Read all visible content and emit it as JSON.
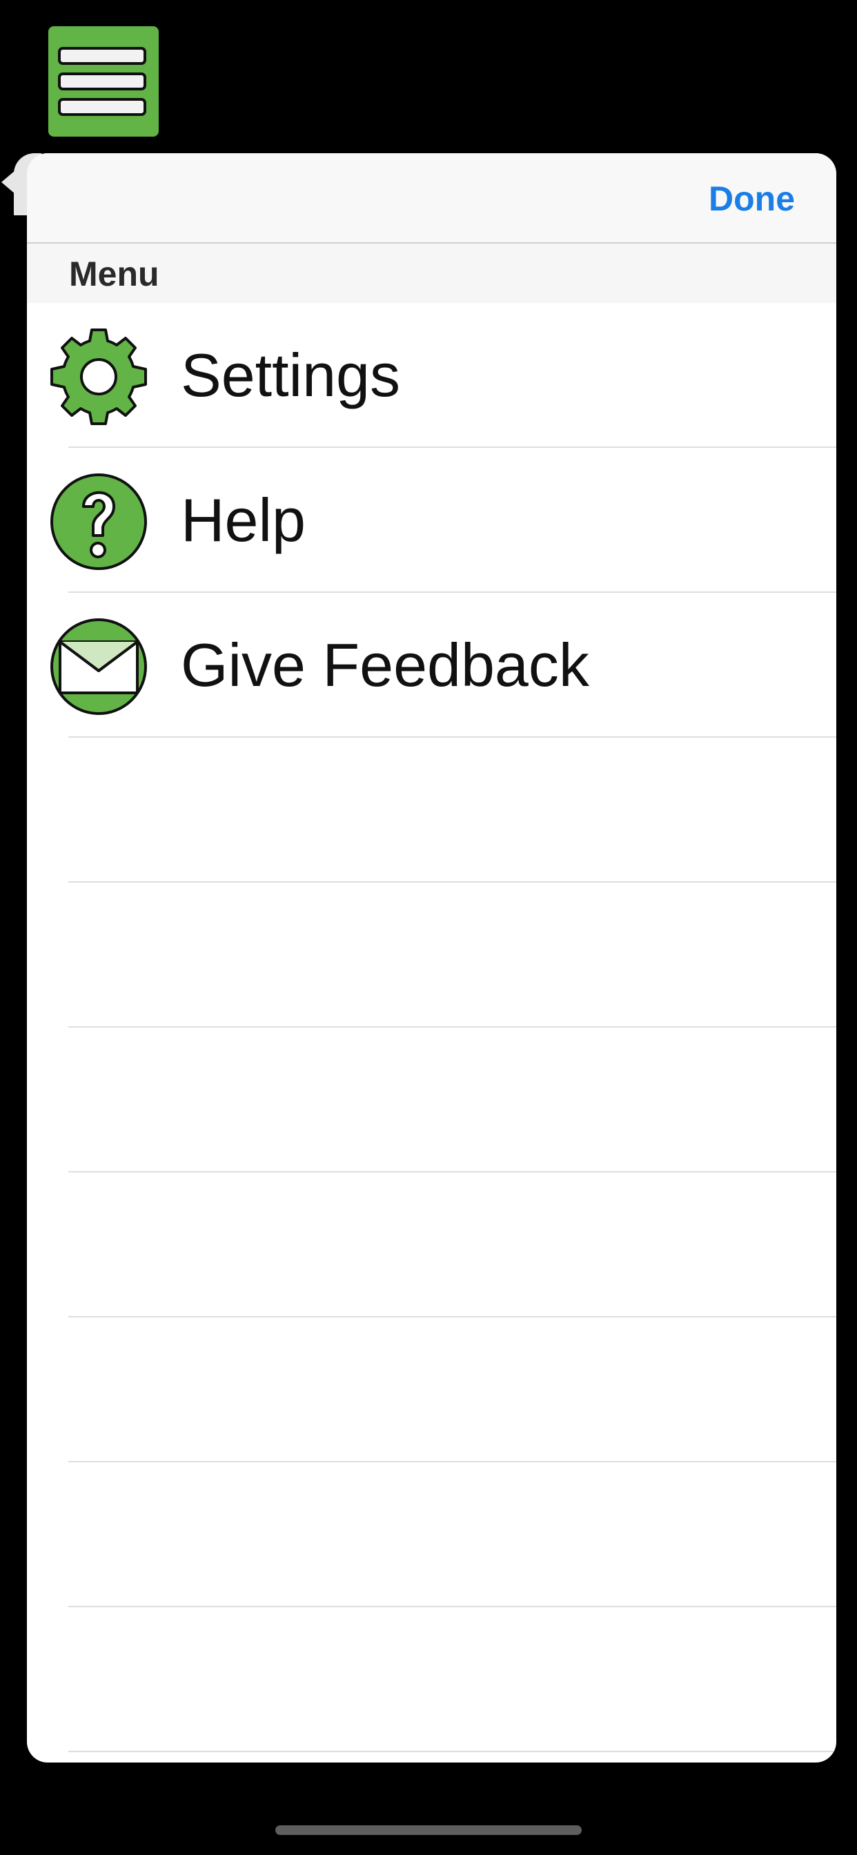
{
  "nav": {
    "done_label": "Done"
  },
  "section": {
    "header": "Menu"
  },
  "menu": {
    "items": [
      {
        "label": "Settings",
        "icon": "gear-icon"
      },
      {
        "label": "Help",
        "icon": "question-mark-icon"
      },
      {
        "label": "Give Feedback",
        "icon": "envelope-icon"
      }
    ]
  },
  "colors": {
    "accent_green": "#62b446",
    "link_blue": "#1a7ee6"
  }
}
